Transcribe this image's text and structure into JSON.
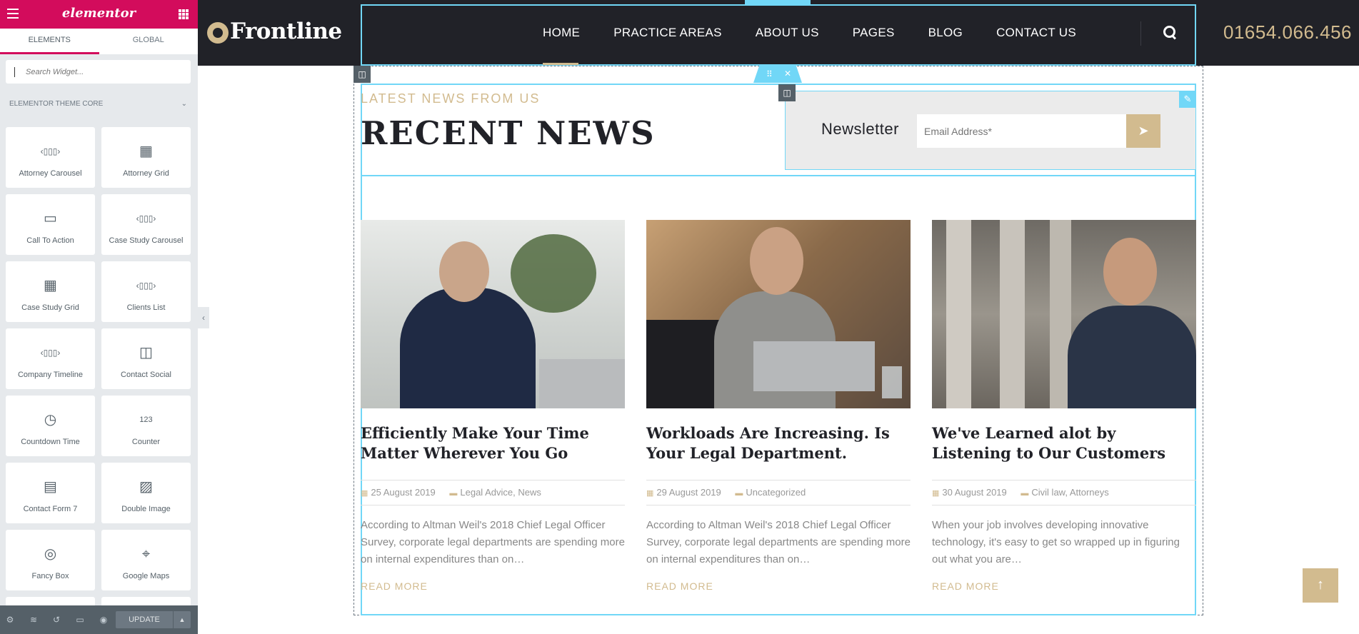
{
  "editor": {
    "logo_text": "elementor",
    "tabs": [
      {
        "label": "ELEMENTS"
      },
      {
        "label": "GLOBAL"
      }
    ],
    "search_placeholder": "Search Widget...",
    "category": "ELEMENTOR THEME CORE",
    "widgets": [
      {
        "label": "Attorney Carousel",
        "icon": "carousel-icon",
        "glyph": "‹▯▯▯›"
      },
      {
        "label": "Attorney Grid",
        "icon": "grid-icon",
        "glyph": "▦"
      },
      {
        "label": "Call To Action",
        "icon": "call-to-action-icon",
        "glyph": "▭"
      },
      {
        "label": "Case Study Carousel",
        "icon": "carousel-icon",
        "glyph": "‹▯▯▯›"
      },
      {
        "label": "Case Study Grid",
        "icon": "grid-icon",
        "glyph": "▦"
      },
      {
        "label": "Clients List",
        "icon": "carousel-icon",
        "glyph": "‹▯▯▯›"
      },
      {
        "label": "Company Timeline",
        "icon": "carousel-icon",
        "glyph": "‹▯▯▯›"
      },
      {
        "label": "Contact Social",
        "icon": "social-icon",
        "glyph": "◫"
      },
      {
        "label": "Countdown Time",
        "icon": "stopwatch-icon",
        "glyph": "◷"
      },
      {
        "label": "Counter",
        "icon": "counter-icon",
        "glyph": "123"
      },
      {
        "label": "Contact Form 7",
        "icon": "form-icon",
        "glyph": "▤"
      },
      {
        "label": "Double Image",
        "icon": "image-icon",
        "glyph": "▨"
      },
      {
        "label": "Fancy Box",
        "icon": "fancy-box-icon",
        "glyph": "◎"
      },
      {
        "label": "Google Maps",
        "icon": "map-icon",
        "glyph": "⌖"
      }
    ],
    "update_label": "UPDATE"
  },
  "site": {
    "brand": "Frontline",
    "nav": [
      {
        "label": "HOME"
      },
      {
        "label": "PRACTICE AREAS"
      },
      {
        "label": "ABOUT US"
      },
      {
        "label": "PAGES"
      },
      {
        "label": "BLOG"
      },
      {
        "label": "CONTACT US"
      }
    ],
    "phone": "01654.066.456",
    "eyebrow": "LATEST NEWS FROM US",
    "heading": "RECENT NEWS",
    "newsletter": {
      "title": "Newsletter",
      "placeholder": "Email Address*"
    },
    "posts": [
      {
        "title": "Efficiently Make Your Time Matter Wherever You Go",
        "date": "25 August 2019",
        "categories": "Legal Advice, News",
        "excerpt": "According to Altman Weil's 2018 Chief Legal Officer Survey, corporate legal departments are spending more on internal expenditures than on…",
        "more": "READ MORE"
      },
      {
        "title": "Workloads Are Increasing. Is Your Legal Department.",
        "date": "29 August 2019",
        "categories": "Uncategorized",
        "excerpt": "According to Altman Weil's 2018 Chief Legal Officer Survey, corporate legal departments are spending more on internal expenditures than on…",
        "more": "READ MORE"
      },
      {
        "title": "We've Learned alot by Listening to Our Customers",
        "date": "30 August 2019",
        "categories": "Civil law, Attorneys",
        "excerpt": "When your job involves developing innovative technology, it's easy to get so wrapped up in figuring out what you are…",
        "more": "READ MORE"
      }
    ]
  },
  "colors": {
    "elementor_pink": "#d30c5c",
    "gold": "#d2bb8f",
    "dark": "#212228",
    "editor_blue": "#71d7f7"
  }
}
